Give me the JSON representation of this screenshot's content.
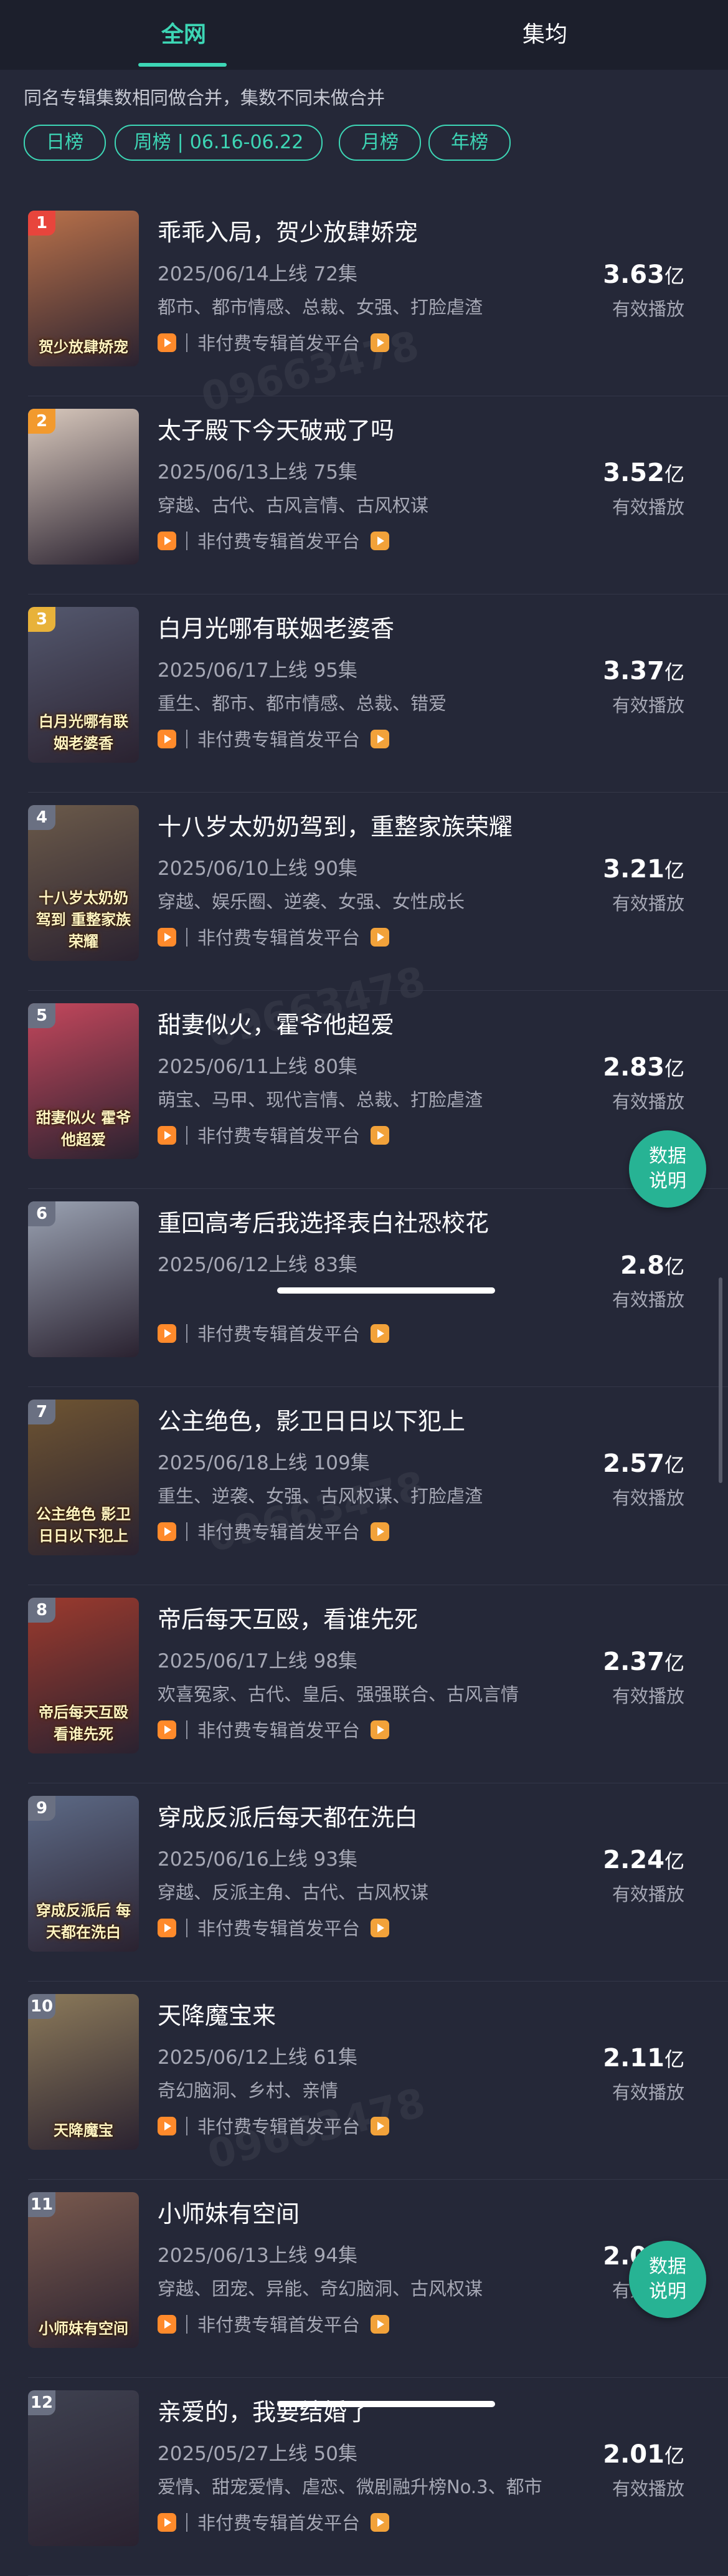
{
  "tabs": {
    "all": "全网",
    "avg": "集均"
  },
  "notice": "同名专辑集数相同做合并，集数不同未做合并",
  "filters": {
    "day": "日榜",
    "week": "周榜",
    "week_range": "06.16-06.22",
    "month": "月榜",
    "year": "年榜"
  },
  "value_label": "有效播放",
  "platform_label": "非付费专辑首发平台",
  "data_button": "数据说明",
  "watermark": "09663478",
  "colors": {
    "accent": "#3dd6b5",
    "background": "#252838"
  },
  "items": [
    {
      "rank": "1",
      "title": "乖乖入局，贺少放肆娇宠",
      "date": "2025/06/14上线 72集",
      "tags": "都市、都市情感、总裁、女强、打脸虐渣",
      "value": "3.63",
      "unit": "亿",
      "poster_text": "贺少放肆娇宠",
      "poster_color": "#b9714a",
      "rank_color": "#e8453c"
    },
    {
      "rank": "2",
      "title": "太子殿下今天破戒了吗",
      "date": "2025/06/13上线 75集",
      "tags": "穿越、古代、古风言情、古风权谋",
      "value": "3.52",
      "unit": "亿",
      "poster_text": "",
      "poster_color": "#d9c9bd",
      "rank_color": "#f29a2e"
    },
    {
      "rank": "3",
      "title": "白月光哪有联姻老婆香",
      "date": "2025/06/17上线 95集",
      "tags": "重生、都市、都市情感、总裁、错爱",
      "value": "3.37",
      "unit": "亿",
      "poster_text": "白月光哪有联姻老婆香",
      "poster_color": "#54586e",
      "rank_color": "#e8b23a"
    },
    {
      "rank": "4",
      "title": "十八岁太奶奶驾到，重整家族荣耀",
      "date": "2025/06/10上线 90集",
      "tags": "穿越、娱乐圈、逆袭、女强、女性成长",
      "value": "3.21",
      "unit": "亿",
      "poster_text": "十八岁太奶奶驾到 重整家族荣耀",
      "poster_color": "#6b5a4a",
      "rank_color": "#6a7082"
    },
    {
      "rank": "5",
      "title": "甜妻似火，霍爷他超爱",
      "date": "2025/06/11上线 80集",
      "tags": "萌宝、马甲、现代言情、总裁、打脸虐渣",
      "value": "2.83",
      "unit": "亿",
      "poster_text": "甜妻似火 霍爷他超爱",
      "poster_color": "#c4475c",
      "rank_color": "#6a7082"
    },
    {
      "rank": "6",
      "title": "重回高考后我选择表白社恐校花",
      "date": "2025/06/12上线 83集",
      "tags": "",
      "value": "2.8",
      "unit": "亿",
      "poster_text": "",
      "poster_color": "#9aa2b2",
      "rank_color": "#6a7082"
    },
    {
      "rank": "7",
      "title": "公主绝色，影卫日日以下犯上",
      "date": "2025/06/18上线 109集",
      "tags": "重生、逆袭、女强、古风权谋、打脸虐渣",
      "value": "2.57",
      "unit": "亿",
      "poster_text": "公主绝色 影卫日日以下犯上",
      "poster_color": "#6e5432",
      "rank_color": "#6a7082"
    },
    {
      "rank": "8",
      "title": "帝后每天互殴，看谁先死",
      "date": "2025/06/17上线 98集",
      "tags": "欢喜冤家、古代、皇后、强强联合、古风言情",
      "value": "2.37",
      "unit": "亿",
      "poster_text": "帝后每天互殴 看谁先死",
      "poster_color": "#9c3a2e",
      "rank_color": "#6a7082"
    },
    {
      "rank": "9",
      "title": "穿成反派后每天都在洗白",
      "date": "2025/06/16上线 93集",
      "tags": "穿越、反派主角、古代、古风权谋",
      "value": "2.24",
      "unit": "亿",
      "poster_text": "穿成反派后 每天都在洗白",
      "poster_color": "#5d6a86",
      "rank_color": "#6a7082"
    },
    {
      "rank": "10",
      "title": "天降魔宝来",
      "date": "2025/06/12上线 61集",
      "tags": "奇幻脑洞、乡村、亲情",
      "value": "2.11",
      "unit": "亿",
      "poster_text": "天降魔宝",
      "poster_color": "#8c7a5a",
      "rank_color": "#6a7082"
    },
    {
      "rank": "11",
      "title": "小师妹有空间",
      "date": "2025/06/13上线 94集",
      "tags": "穿越、团宠、异能、奇幻脑洞、古风权谋",
      "value": "2.02",
      "unit": "亿",
      "poster_text": "小师妹有空间",
      "poster_color": "#7a5a4e",
      "rank_color": "#6a7082"
    },
    {
      "rank": "12",
      "title": "亲爱的，我要结婚了",
      "date": "2025/05/27上线 50集",
      "tags": "爱情、甜宠爱情、虐恋、微剧融升榜No.3、都市",
      "value": "2.01",
      "unit": "亿",
      "poster_text": "",
      "poster_color": "#3e4150",
      "rank_color": "#6a7082"
    }
  ]
}
